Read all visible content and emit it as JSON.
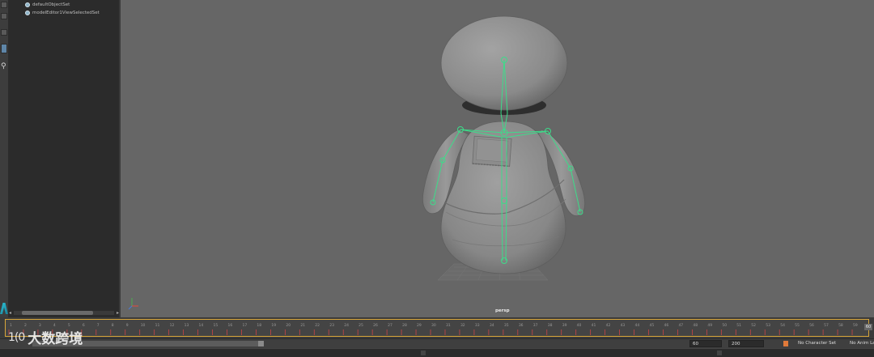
{
  "outliner": {
    "items": [
      {
        "label": "defaultObjectSet",
        "icon": "set-icon"
      },
      {
        "label": "modelEditor1ViewSelectedSet",
        "icon": "set-icon"
      }
    ]
  },
  "viewport": {
    "camera_label": "persp",
    "mesh_color": "#8f8f8f",
    "joint_color": "#3ddc8a",
    "background": "#666666"
  },
  "timeline": {
    "ticks": [
      "1",
      "2",
      "3",
      "4",
      "5",
      "6",
      "7",
      "8",
      "9",
      "10",
      "11",
      "12",
      "13",
      "14",
      "15",
      "16",
      "17",
      "18",
      "19",
      "20",
      "21",
      "22",
      "23",
      "24",
      "25",
      "26",
      "27",
      "28",
      "29",
      "30",
      "31",
      "32",
      "33",
      "34",
      "35",
      "36",
      "37",
      "38",
      "39",
      "40",
      "41",
      "42",
      "43",
      "44",
      "45",
      "46",
      "47",
      "48",
      "49",
      "50",
      "51",
      "52",
      "53",
      "54",
      "55",
      "56",
      "57",
      "58",
      "59"
    ],
    "current_frame": "60",
    "highlight_color": "#d8a63a"
  },
  "range": {
    "end_time": "60",
    "anim_end": "200",
    "character_set": "No Character Set",
    "anim_layer": "No Anim La"
  },
  "watermark": {
    "logo": "1(0",
    "text": "大数跨境"
  }
}
